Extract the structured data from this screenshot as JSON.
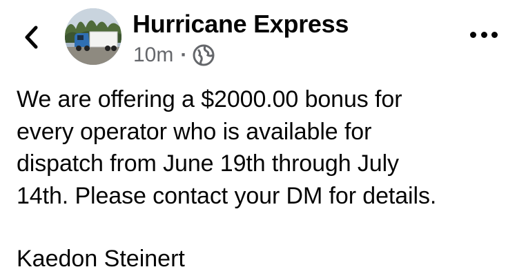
{
  "post": {
    "author": "Hurricane Express",
    "time": "10m",
    "separator": "·",
    "audience_icon": "globe-icon",
    "body": "We are offering a $2000.00 bonus for\nevery operator who is available for\ndispatch from June 19th through July\n14th.   Please contact your DM for details.",
    "signature": "Kaedon Steinert"
  },
  "icons": {
    "back": "chevron-left-icon",
    "more": "more-horizontal-icon",
    "avatar": "truck-avatar"
  },
  "colors": {
    "text": "#050505",
    "secondary_text": "#65676b",
    "background": "#ffffff"
  }
}
